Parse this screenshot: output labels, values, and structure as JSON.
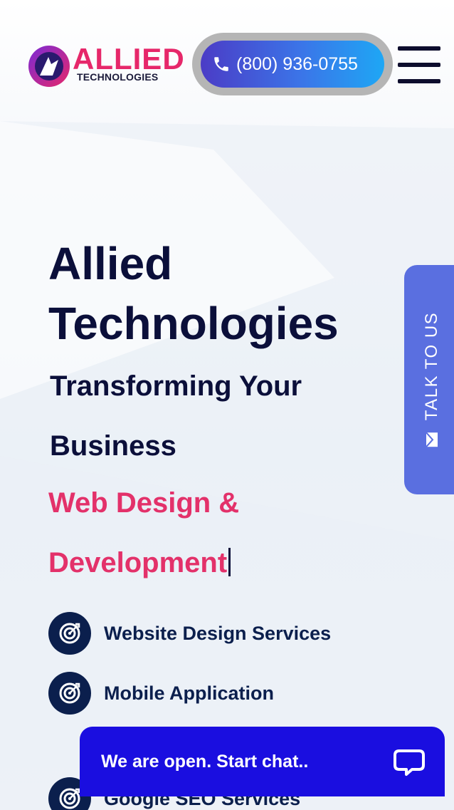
{
  "header": {
    "logo_text": "ALLIED",
    "logo_subtext": "TECHNOLOGIES",
    "phone_number": "(800) 936-0755"
  },
  "hero": {
    "title_line1": "Allied",
    "title_line2": "Technologies",
    "subtitle": "Transforming Your Business",
    "typed_text": "Web Design & Development"
  },
  "services": [
    {
      "label": "Website Design Services"
    },
    {
      "label": "Mobile Application"
    },
    {
      "label": "Google SEO Services"
    }
  ],
  "side_tab": {
    "label": "TALK TO US"
  },
  "chat": {
    "label": "We are open. Start chat.."
  },
  "colors": {
    "brand_navy": "#0b0f3a",
    "brand_pink": "#e3316a",
    "chat_blue": "#1a0ee0",
    "talk_tab": "#5a6fe0"
  },
  "icons": [
    "logo-mark-icon",
    "phone-icon",
    "hamburger-menu-icon",
    "target-icon",
    "mail-icon",
    "chat-bubble-icon"
  ]
}
